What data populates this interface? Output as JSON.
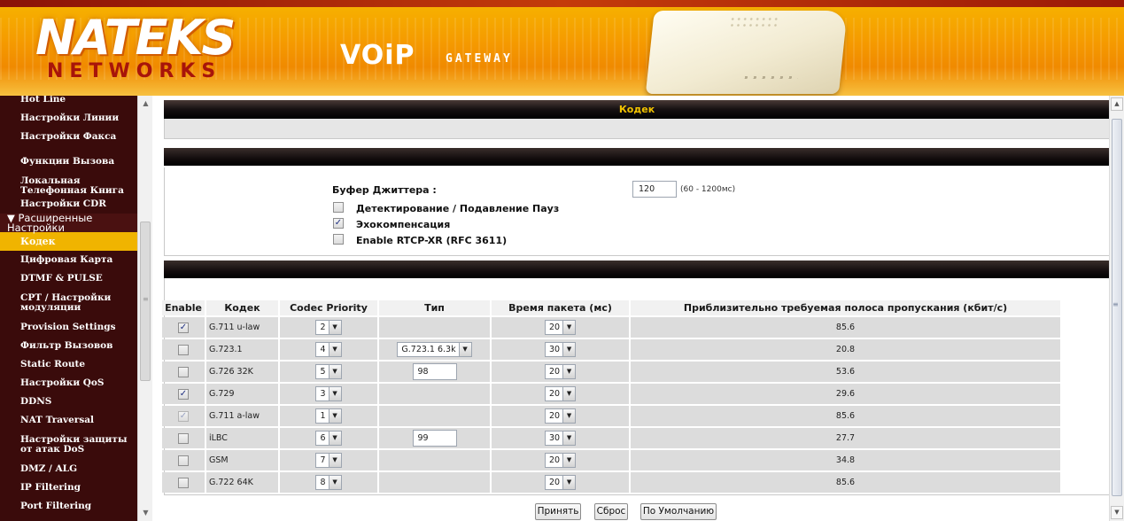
{
  "banner": {
    "logo_main": "NATEKS",
    "logo_sub": "NETWORKS",
    "product_voip": "VOiP",
    "product_gateway": "GATEWAY"
  },
  "sidebar": {
    "items": [
      {
        "label": "Hot Line",
        "type": "item"
      },
      {
        "label": "Настройки Линии",
        "type": "item"
      },
      {
        "label": "Настройки Факса",
        "type": "item"
      },
      {
        "label": "Функции Вызова",
        "type": "item"
      },
      {
        "label": "Локальная Телефонная Книга",
        "type": "item"
      },
      {
        "label": "Настройки CDR",
        "type": "item"
      },
      {
        "label": "▼ Расширенные Настройки",
        "type": "group"
      },
      {
        "label": "Кодек",
        "type": "active"
      },
      {
        "label": "Цифровая Карта",
        "type": "item"
      },
      {
        "label": "DTMF & PULSE",
        "type": "item"
      },
      {
        "label": "CPT / Настройки модуляции",
        "type": "item"
      },
      {
        "label": "Provision Settings",
        "type": "item"
      },
      {
        "label": "Фильтр Вызовов",
        "type": "item"
      },
      {
        "label": "Static Route",
        "type": "item"
      },
      {
        "label": "Настройки QoS",
        "type": "item"
      },
      {
        "label": "DDNS",
        "type": "item"
      },
      {
        "label": "NAT Traversal",
        "type": "item"
      },
      {
        "label": "Настройки защиты от атак DoS",
        "type": "item"
      },
      {
        "label": "DMZ / ALG",
        "type": "item"
      },
      {
        "label": "IP Filtering",
        "type": "item"
      },
      {
        "label": "Port Filtering",
        "type": "item"
      }
    ]
  },
  "page": {
    "title": "Кодек"
  },
  "settings": {
    "jitter_label": "Буфер Джиттера :",
    "jitter_value": "120",
    "jitter_hint": "(60 - 1200мс)",
    "vad_label": "Детектирование / Подавление Пауз",
    "vad_checked": false,
    "echo_label": "Эхокомпенсация",
    "echo_checked": true,
    "rtcp_label": "Enable RTCP-XR (RFC 3611)",
    "rtcp_checked": false
  },
  "codec_table": {
    "headers": {
      "enable": "Enable",
      "codec": "Кодек",
      "priority": "Codec Priority",
      "type": "Тип",
      "packet": "Время пакета (мс)",
      "bandwidth": "Приблизительно требуемая полоса пропускания (кбит/с)"
    },
    "rows": [
      {
        "enable": "on",
        "codec": "G.711 u-law",
        "priority": "2",
        "type_kind": "none",
        "type_value": "",
        "packet": "20",
        "bandwidth": "85.6"
      },
      {
        "enable": "off",
        "codec": "G.723.1",
        "priority": "4",
        "type_kind": "select",
        "type_value": "G.723.1 6.3k",
        "packet": "30",
        "bandwidth": "20.8"
      },
      {
        "enable": "off",
        "codec": "G.726 32K",
        "priority": "5",
        "type_kind": "input",
        "type_value": "98",
        "packet": "20",
        "bandwidth": "53.6"
      },
      {
        "enable": "on",
        "codec": "G.729",
        "priority": "3",
        "type_kind": "none",
        "type_value": "",
        "packet": "20",
        "bandwidth": "29.6"
      },
      {
        "enable": "dim",
        "codec": "G.711 a-law",
        "priority": "1",
        "type_kind": "none",
        "type_value": "",
        "packet": "20",
        "bandwidth": "85.6"
      },
      {
        "enable": "off",
        "codec": "iLBC",
        "priority": "6",
        "type_kind": "input",
        "type_value": "99",
        "packet": "30",
        "bandwidth": "27.7"
      },
      {
        "enable": "off",
        "codec": "GSM",
        "priority": "7",
        "type_kind": "none",
        "type_value": "",
        "packet": "20",
        "bandwidth": "34.8"
      },
      {
        "enable": "off",
        "codec": "G.722 64K",
        "priority": "8",
        "type_kind": "none",
        "type_value": "",
        "packet": "20",
        "bandwidth": "85.6"
      }
    ]
  },
  "buttons": {
    "apply": "Принять",
    "reset": "Сброс",
    "default": "По Умолчанию"
  },
  "icons": {
    "dropdown": "chevron-down-icon",
    "scroll_up": "arrow-up-icon",
    "scroll_down": "arrow-down-icon",
    "checkbox": "checkmark-icon"
  },
  "colors": {
    "banner_orange": "#f59a00",
    "sidebar_bg": "#3a0b0b",
    "active_item": "#f0b400",
    "title_text": "#f2c300"
  }
}
